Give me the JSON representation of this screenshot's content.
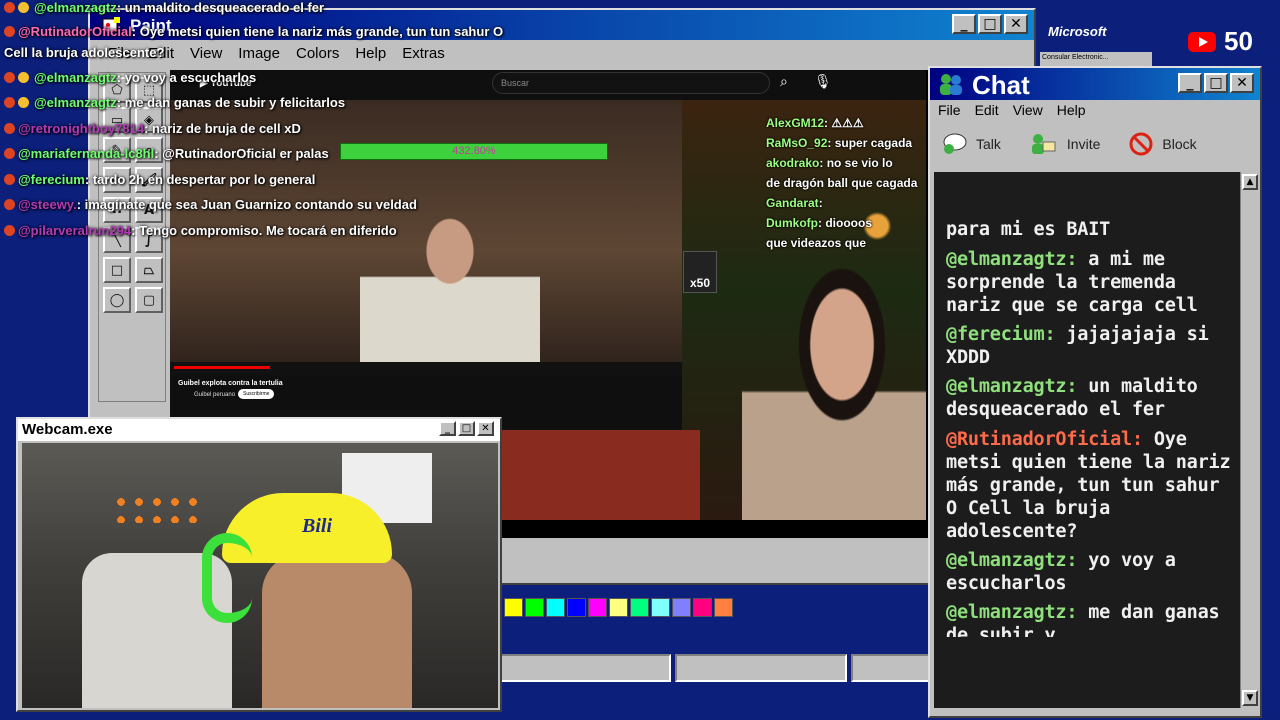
{
  "paint": {
    "title": "Paint",
    "menu": [
      "File",
      "Edit",
      "View",
      "Image",
      "Colors",
      "Help",
      "Extras"
    ],
    "palette": [
      "#ffff00",
      "#00ff00",
      "#00ffff",
      "#0000ff",
      "#ff00ff",
      "#ffff80",
      "#00ff80",
      "#80ffff",
      "#8080ff",
      "#ff0080",
      "#ff8040"
    ]
  },
  "youtube": {
    "search_placeholder": "Buscar",
    "video_title": "Guibel explota contra la tertulia",
    "channel": "Guibel peruano",
    "subscribe": "Suscribirme",
    "health_text": "432.80%",
    "x50": "x50",
    "stream_chat": [
      {
        "user": "AlexGM12",
        "text": ": ⚠⚠⚠"
      },
      {
        "user": "RaMsO_92",
        "text": ": super cagada"
      },
      {
        "user": "akodrako",
        "text": ": no se vio lo"
      },
      {
        "user": "",
        "text": "de dragón ball que cagada"
      },
      {
        "user": "Gandarat",
        "text": ":"
      },
      {
        "user": "Dumkofp",
        "text": ": dioooos"
      },
      {
        "user": "",
        "text": "que videazos que"
      }
    ]
  },
  "overlay_chat": [
    {
      "user": "@elmanzagtz",
      "text": ": un maldito desqueacerado el fer",
      "color": "g"
    },
    {
      "user": "@RutinadorOficial",
      "text": ": Oye metsi quien tiene la nariz más grande, tun tun sahur O",
      "color": "p"
    },
    {
      "user": "",
      "text": "Cell la bruja adolescente?",
      "color": ""
    },
    {
      "user": "@elmanzagtz",
      "text": ": yo voy a escucharlos",
      "color": "g"
    },
    {
      "user": "@elmanzagtz",
      "text": ": me dan ganas de subir y felicitarlos",
      "color": "g"
    },
    {
      "user": "@retronightboy7814",
      "text": ": nariz de bruja de cell xD",
      "color": "d"
    },
    {
      "user": "@mariafernanda-lc8hl",
      "text": ": @RutinadorOficial er palas",
      "color": "g"
    },
    {
      "user": "@ferecium",
      "text": ": tardo 2h en despertar por lo general",
      "color": "g"
    },
    {
      "user": "@steewy.",
      "text": ": imagínate que sea Juan Guarnizo contando su veldad",
      "color": "d"
    },
    {
      "user": "@pilarveralrun294",
      "text": ": Tengo compromiso. Me tocará en diferido",
      "color": "d"
    }
  ],
  "chat": {
    "title": "Chat",
    "menu": [
      "File",
      "Edit",
      "View",
      "Help"
    ],
    "tools": {
      "talk": "Talk",
      "invite": "Invite",
      "block": "Block"
    },
    "messages": [
      {
        "user": "",
        "text": "para mi es BAIT",
        "color": "g"
      },
      {
        "user": "@elmanzagtz:",
        "text": " a mi me sorprende la tremenda nariz que se carga cell",
        "color": "g"
      },
      {
        "user": "@ferecium:",
        "text": " jajajajaja si XDDD",
        "color": "g"
      },
      {
        "user": "@elmanzagtz:",
        "text": " un maldito desqueacerado el fer",
        "color": "g"
      },
      {
        "user": "@RutinadorOficial:",
        "text": " Oye metsi quien tiene la nariz más grande, tun tun sahur O Cell la bruja adolescente?",
        "color": "r"
      },
      {
        "user": "@elmanzagtz:",
        "text": " yo voy a escucharlos",
        "color": "g"
      },
      {
        "user": "@elmanzagtz:",
        "text": " me dan ganas de subir y",
        "color": "g"
      }
    ]
  },
  "webcam": {
    "title": "Webcam.exe",
    "cap_text": "Bili"
  },
  "overlay": {
    "microsoft": "Microsoft",
    "microsoft_sub": "Consular Electronic...",
    "viewer_count": "50"
  }
}
